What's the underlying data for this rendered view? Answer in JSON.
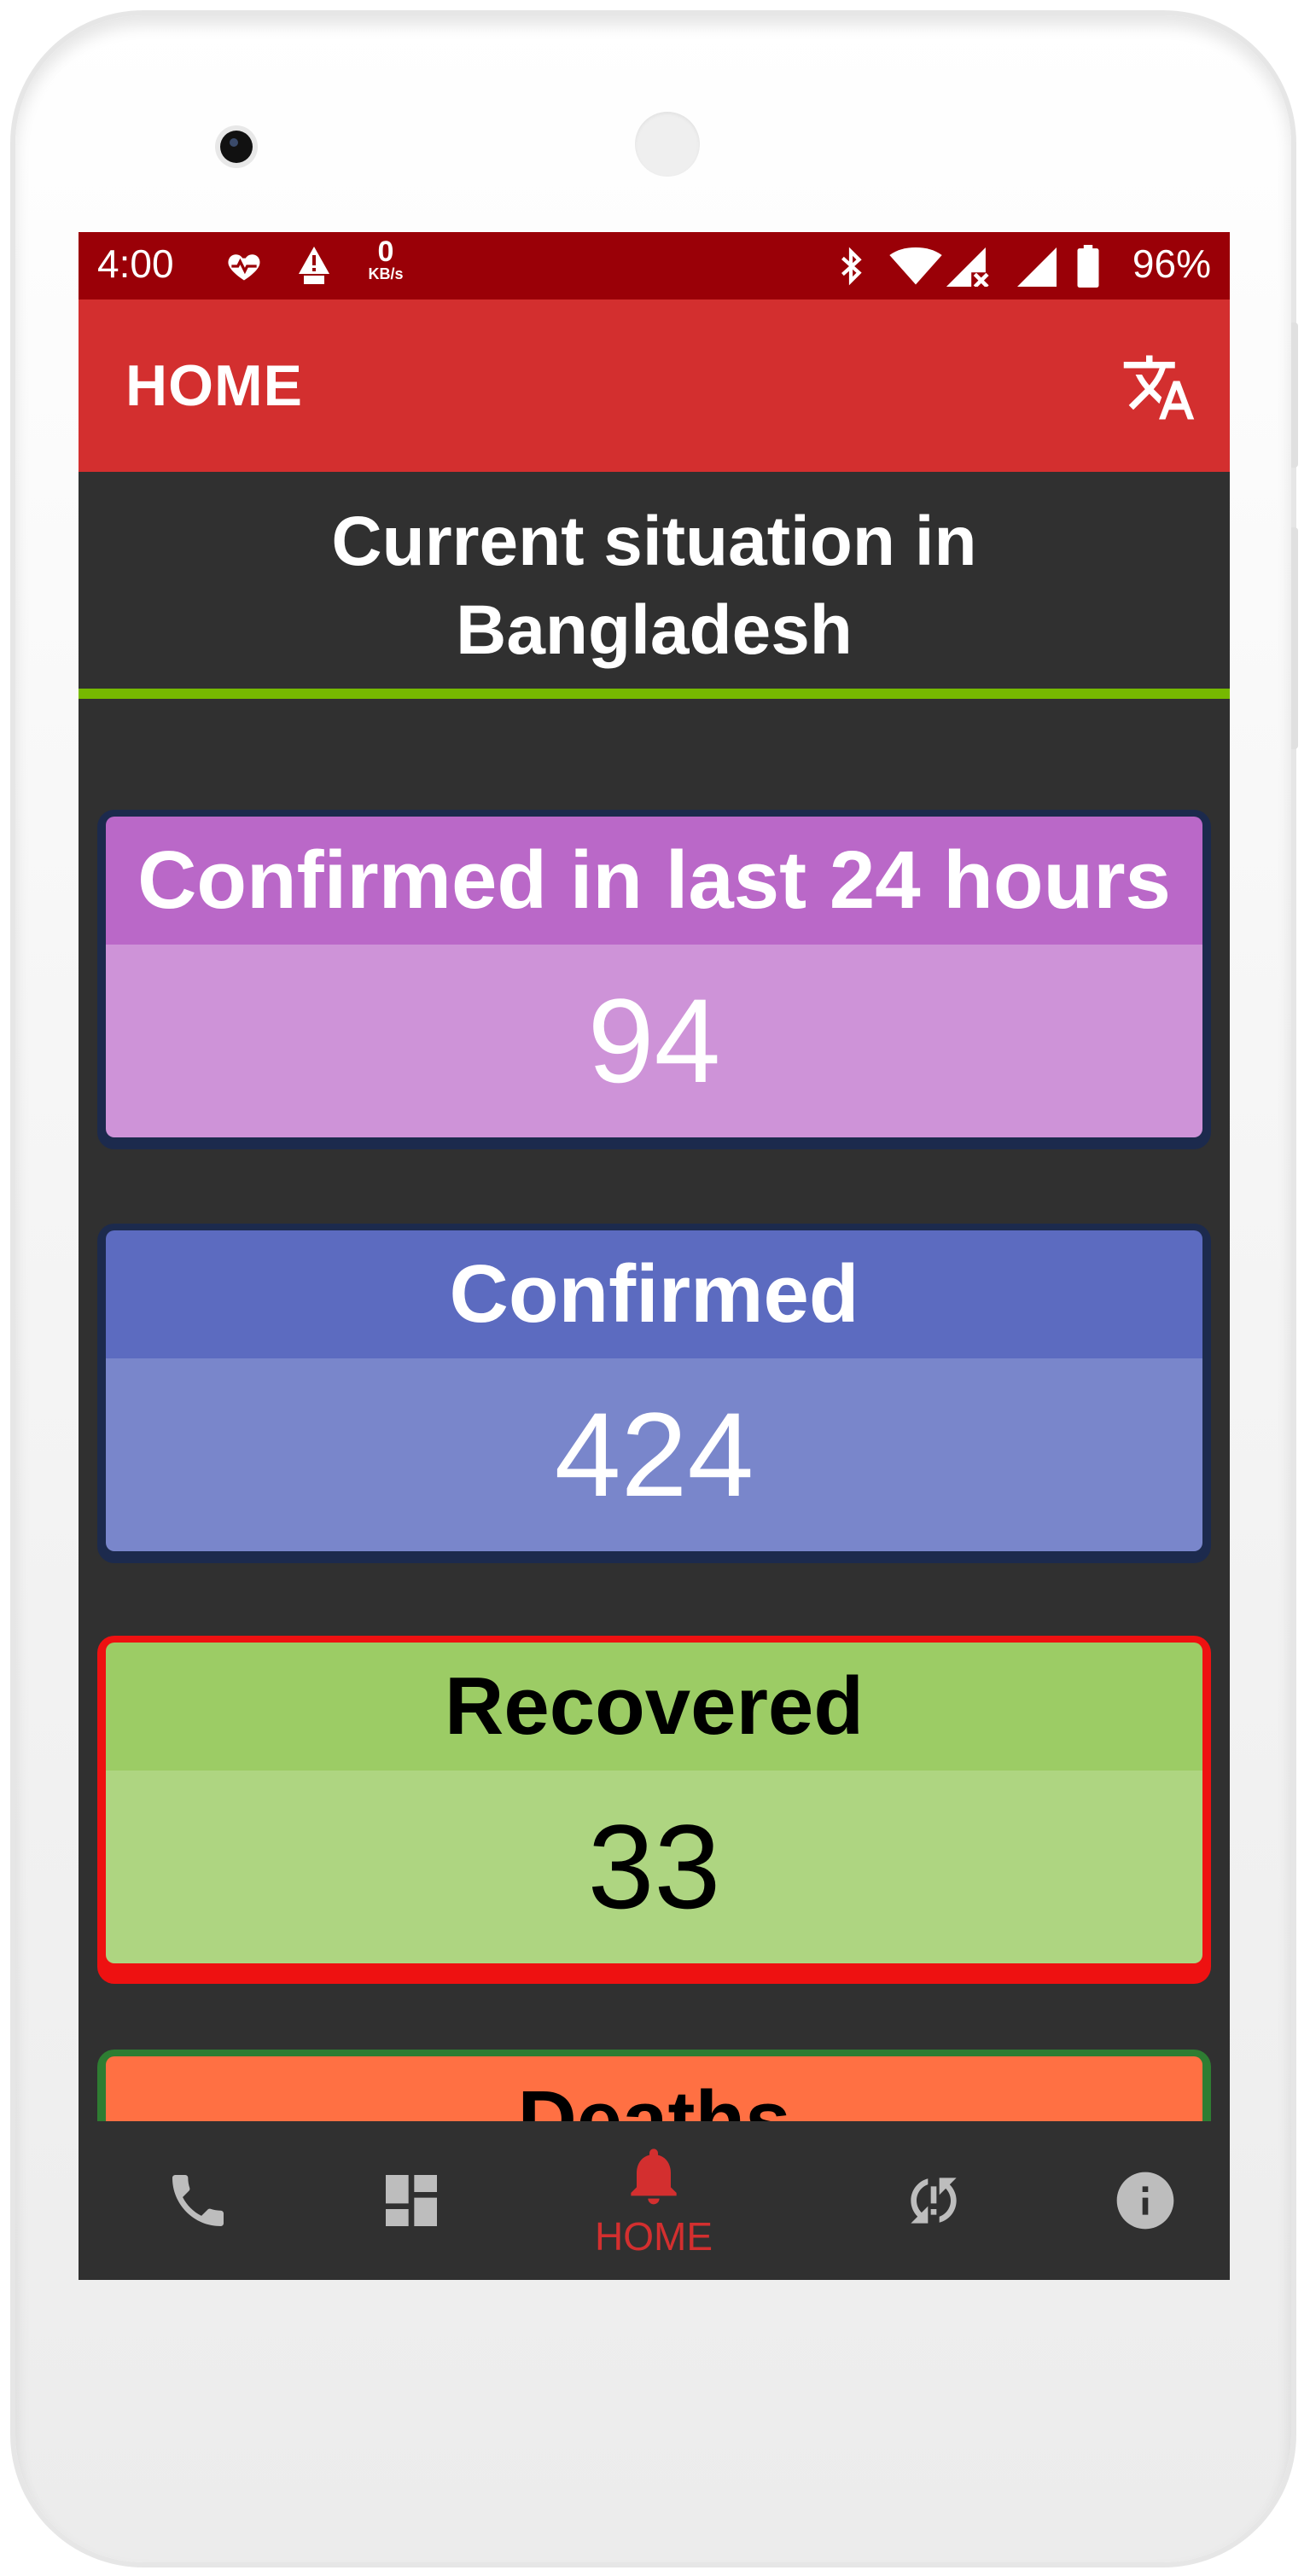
{
  "status_bar": {
    "time": "4:00",
    "network_speed_value": "0",
    "network_speed_unit": "KB/s",
    "battery_percent": "96%",
    "icons": [
      "heart-pulse-icon",
      "alert-icon",
      "bluetooth-icon",
      "wifi-icon",
      "cell-signal-x-icon",
      "cell-signal-icon",
      "battery-icon"
    ]
  },
  "app_bar": {
    "title": "HOME",
    "action_icon": "translate-icon"
  },
  "heading": {
    "line1": "Current situation in",
    "line2": "Bangladesh"
  },
  "cards": [
    {
      "title": "Confirmed in last 24 hours",
      "value": "94"
    },
    {
      "title": "Confirmed",
      "value": "424"
    },
    {
      "title": "Recovered",
      "value": "33"
    },
    {
      "title": "Deaths",
      "value": ""
    }
  ],
  "bottom_nav": {
    "items": [
      {
        "icon": "phone-icon",
        "label": ""
      },
      {
        "icon": "dashboard-icon",
        "label": ""
      },
      {
        "icon": "bell-icon",
        "label": "HOME",
        "active": true
      },
      {
        "icon": "sync-alert-icon",
        "label": ""
      },
      {
        "icon": "info-icon",
        "label": ""
      }
    ]
  },
  "colors": {
    "status_bar": "#9a0007",
    "app_bar": "#d32f2f",
    "background": "#303030",
    "accent_line": "#76b900",
    "active_nav": "#d32f2f"
  }
}
